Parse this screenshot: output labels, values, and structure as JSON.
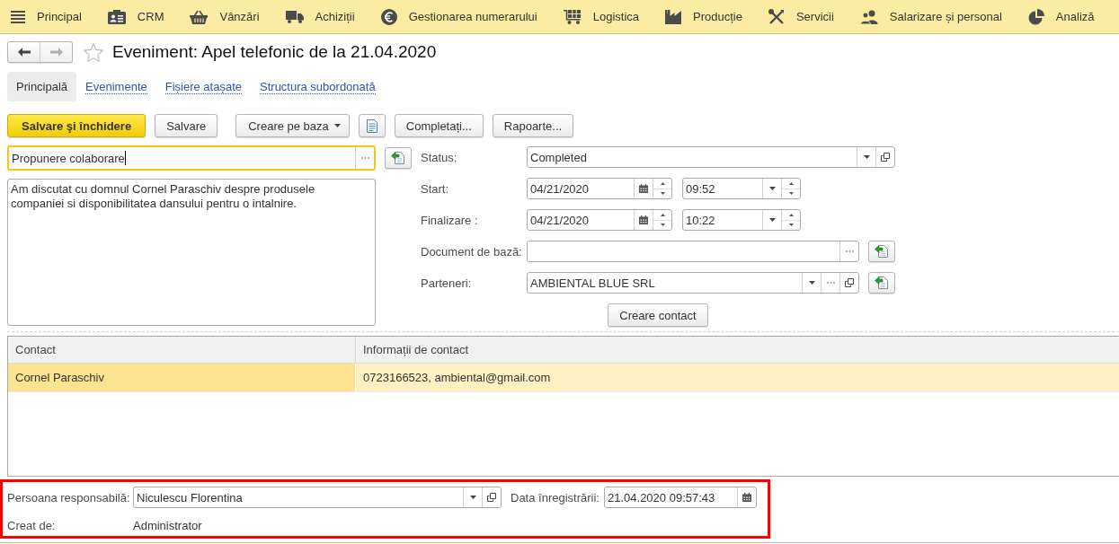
{
  "sections": [
    {
      "label": "Principal"
    },
    {
      "label": "CRM"
    },
    {
      "label": "Vânzări"
    },
    {
      "label": "Achiziții"
    },
    {
      "label": "Gestionarea numerarului"
    },
    {
      "label": "Logistica"
    },
    {
      "label": "Producție"
    },
    {
      "label": "Servicii"
    },
    {
      "label": "Salarizare și personal"
    },
    {
      "label": "Analiză"
    }
  ],
  "nav": {
    "back": {
      "disabled": false
    },
    "forward": {
      "disabled": true
    },
    "favorite": false,
    "title": "Eveniment: Apel telefonic de la 21.04.2020"
  },
  "tabs": [
    {
      "label": "Principală",
      "selected": true
    },
    {
      "label": "Evenimente",
      "selected": false
    },
    {
      "label": "Fișiere atașate",
      "selected": false
    },
    {
      "label": "Structura subordonată",
      "selected": false
    }
  ],
  "toolbar": [
    {
      "kind": "primary",
      "label": "Salvare şi închidere"
    },
    {
      "kind": "plain",
      "label": "Salvare"
    },
    {
      "kind": "dropdown",
      "label": "Creare pe baza"
    },
    {
      "kind": "icon"
    },
    {
      "kind": "plain",
      "label": "Completați..."
    },
    {
      "kind": "plain",
      "label": "Rapoarte..."
    }
  ],
  "form": {
    "subject": {
      "value": "Propunere colaborare",
      "focused": true
    },
    "description": "Am discutat cu domnul Cornel Paraschiv despre produsele companiei si disponibilitatea dansului pentru o intalnire.",
    "status": {
      "label": "Status:",
      "value": "Completed"
    },
    "start": {
      "label": "Start:",
      "date": "04/21/2020",
      "time": "09:52"
    },
    "end": {
      "label": "Finalizare :",
      "date": "04/21/2020",
      "time": "10:22"
    },
    "base_document": {
      "label": "Document de bază:"
    },
    "partners": {
      "label": "Parteneri:",
      "value": "AMBIENTAL BLUE SRL"
    },
    "create_contact": "Creare contact"
  },
  "table": {
    "columns": [
      "Contact",
      "Informații de contact"
    ],
    "rows": [
      {
        "cells": [
          "Cornel Paraschiv",
          "0723166523, ambiental@gmail.com"
        ],
        "selected": true
      }
    ]
  },
  "footer": {
    "responsible": {
      "label": "Persoana responsabilă:",
      "value": "Niculescu Florentina"
    },
    "registration_date": {
      "label": "Data înregistrării:",
      "value": "21.04.2020 09:57:43"
    },
    "created_by": {
      "label": "Creat de:",
      "value": "Administrator"
    }
  }
}
